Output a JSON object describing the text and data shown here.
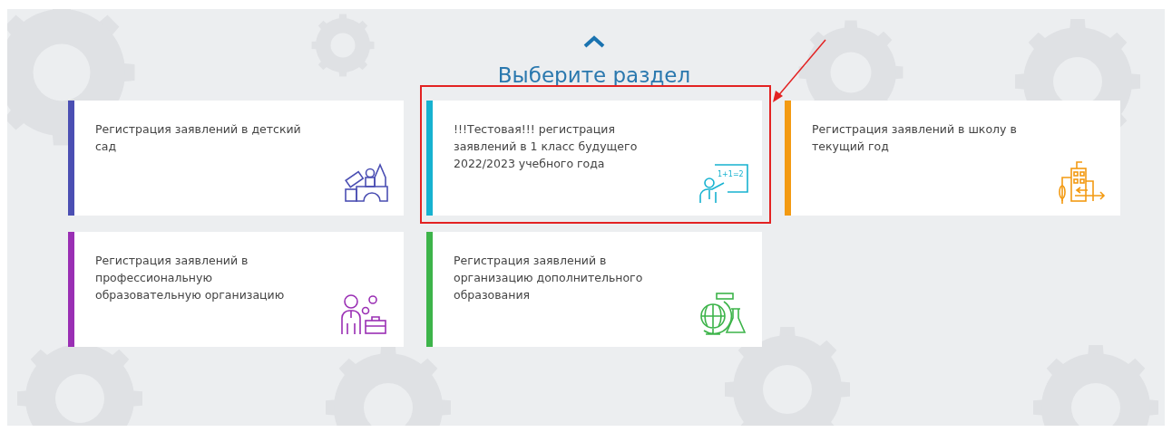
{
  "heading": "Выберите раздел",
  "cards": [
    {
      "lines": [
        "Регистрация заявлений в детский",
        "сад"
      ],
      "color": "#4b4fb3",
      "highlighted": false
    },
    {
      "lines": [
        "!!!Тестовая!!! регистрация",
        "заявлений в 1 класс будущего",
        "2022/2023 учебного года"
      ],
      "color": "#17b2d0",
      "board_text": "1+1=2",
      "highlighted": true
    },
    {
      "lines": [
        "Регистрация заявлений в школу в",
        "текущий год"
      ],
      "color": "#f39a12",
      "highlighted": false
    },
    {
      "lines": [
        "Регистрация заявлений в",
        "профессиональную",
        "образовательную организацию"
      ],
      "color": "#9a2fb4",
      "highlighted": false
    },
    {
      "lines": [
        "Регистрация заявлений в",
        "организацию дополнительного",
        "образования"
      ],
      "color": "#3db44a",
      "highlighted": false
    }
  ]
}
